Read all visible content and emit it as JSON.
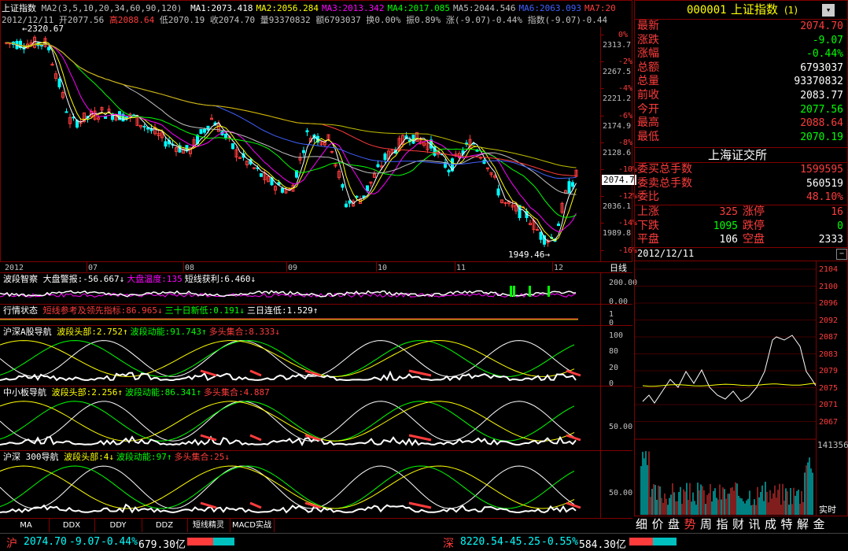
{
  "main_chart": {
    "title": "上证指数",
    "ma_label": "MA2(3,5,10,20,34,60,90,120)",
    "mas": [
      {
        "label": "MA1:2073.418",
        "color": "#ffffff"
      },
      {
        "label": "MA2:2056.284",
        "color": "#ffff00"
      },
      {
        "label": "MA3:2013.342",
        "color": "#ff00ff"
      },
      {
        "label": "MA4:2017.085",
        "color": "#00ff00"
      },
      {
        "label": "MA5:2044.546",
        "color": "#c0c0c0"
      },
      {
        "label": "MA6:2063.093",
        "color": "#4060ff"
      },
      {
        "label": "MA7:20",
        "color": "#ff3c3c"
      }
    ],
    "ohlc": {
      "date": "2012/12/11",
      "open": "开2077.56",
      "high": "高2088.64",
      "low": "低2070.19",
      "close": "收2074.70",
      "volume": "量93370832",
      "amount": "额6793037",
      "turnover": "换0.00%",
      "amplitude": "振0.89%",
      "change": "涨(-9.07)-0.44%",
      "index_change": "指数(-9.07)-0.44"
    },
    "high_marker": "2320.67",
    "low_marker": "1949.46",
    "current_tag": "2074.7",
    "y_axis": [
      {
        "pct": "0%",
        "val": "2313.7"
      },
      {
        "pct": "-2%",
        "val": "2267.5"
      },
      {
        "pct": "-4%",
        "val": "2221.2"
      },
      {
        "pct": "-6%",
        "val": "2174.9"
      },
      {
        "pct": "-8%",
        "val": "2128.6"
      },
      {
        "pct": "-10%",
        "val": "2082.3"
      },
      {
        "pct": "-12%",
        "val": "2036.1"
      },
      {
        "pct": "-14%",
        "val": "1989.8"
      },
      {
        "pct": "-16%",
        "val": ""
      }
    ],
    "x_axis": [
      "2012",
      "07",
      "08",
      "09",
      "10",
      "11",
      "12"
    ],
    "period_label": "日线"
  },
  "indicators": [
    {
      "name": "波段智察",
      "parts": [
        {
          "t": "大盘警报:-56.667↓",
          "c": "#ffffff"
        },
        {
          "t": "大盘温度:135",
          "c": "#ff00ff"
        },
        {
          "t": "短线获利:6.460↓",
          "c": "#ffffff"
        }
      ],
      "axis": [
        "200.00",
        "0.00"
      ]
    },
    {
      "name": "行情状态",
      "parts": [
        {
          "t": "短线参考及领先指标:86.965↓",
          "c": "#ff3c3c"
        },
        {
          "t": "三十日新低:0.191↓",
          "c": "#00ff00"
        },
        {
          "t": "三日连低:1.529↑",
          "c": "#ffffff"
        }
      ],
      "axis": [
        "1",
        "0"
      ]
    },
    {
      "name": "沪深A股导航",
      "parts": [
        {
          "t": "波段头部:2.752↑",
          "c": "#ffff00"
        },
        {
          "t": "波段动能:91.743↑",
          "c": "#00ff00"
        },
        {
          "t": "多头集合:8.333↓",
          "c": "#ff3c3c"
        }
      ],
      "axis": [
        "100",
        "80",
        "20",
        "0"
      ]
    },
    {
      "name": "中小板导航",
      "parts": [
        {
          "t": "波段头部:2.256↑",
          "c": "#ffff00"
        },
        {
          "t": "波段动能:86.341↑",
          "c": "#00ff00"
        },
        {
          "t": "多头集合:4.887",
          "c": "#ff3c3c"
        }
      ],
      "axis": [
        "50.00"
      ]
    },
    {
      "name": "沪深 300导航",
      "parts": [
        {
          "t": "波段头部:4↓",
          "c": "#ffff00"
        },
        {
          "t": "波段动能:97↑",
          "c": "#00ff00"
        },
        {
          "t": "多头集合:25↓",
          "c": "#ff3c3c"
        }
      ],
      "axis": [
        "50.00"
      ]
    }
  ],
  "bottom_tabs": [
    "MA",
    "DDX",
    "DDY",
    "DDZ",
    "短线精灵",
    "MACD实战"
  ],
  "quote_panel": {
    "code": "000001",
    "name": "上证指数",
    "suffix": "(1)",
    "rows": [
      {
        "label": "最新",
        "value": "2074.70",
        "color": "#ff3c3c"
      },
      {
        "label": "涨跌",
        "value": "-9.07",
        "color": "#00ff00"
      },
      {
        "label": "涨幅",
        "value": "-0.44%",
        "color": "#00ff00"
      },
      {
        "label": "总额",
        "value": "6793037",
        "color": "#ffffff"
      },
      {
        "label": "总量",
        "value": "93370832",
        "color": "#ffffff"
      },
      {
        "label": "前收",
        "value": "2083.77",
        "color": "#ffffff"
      },
      {
        "label": "今开",
        "value": "2077.56",
        "color": "#00ff00"
      },
      {
        "label": "最高",
        "value": "2088.64",
        "color": "#ff3c3c"
      },
      {
        "label": "最低",
        "value": "2070.19",
        "color": "#00ff00"
      }
    ],
    "exchange": "上海证交所",
    "ex_rows": [
      {
        "label": "委买总手数",
        "value": "1599595",
        "color": "#ff3c3c"
      },
      {
        "label": "委卖总手数",
        "value": "560519",
        "color": "#ffffff"
      },
      {
        "label": "委比",
        "value": "48.10%",
        "color": "#ff3c3c"
      }
    ],
    "breadth": [
      {
        "l1": "上涨",
        "v1": "325",
        "c1": "#ff3c3c",
        "l2": "涨停",
        "v2": "16",
        "c2": "#ff3c3c"
      },
      {
        "l1": "下跌",
        "v1": "1095",
        "c1": "#00ff00",
        "l2": "跌停",
        "v2": "0",
        "c2": "#00ff00"
      },
      {
        "l1": "平盘",
        "v1": "106",
        "c1": "#ffffff",
        "l2": "空盘",
        "v2": "2333",
        "c2": "#ffffff"
      }
    ]
  },
  "intraday": {
    "date": "2012/12/11",
    "y_axis": [
      "2104",
      "2100",
      "2096",
      "2092",
      "2087",
      "2083",
      "2079",
      "2075",
      "2071",
      "2067"
    ],
    "vol_max": "141356",
    "realtime": "实时"
  },
  "right_tabs": [
    "细",
    "价",
    "盘",
    "势",
    "周",
    "指",
    "财",
    "讯",
    "成",
    "特",
    "解",
    "金"
  ],
  "status_bar": {
    "sh_label": "沪",
    "sh_price": "2074.70",
    "sh_chg": "-9.07",
    "sh_pct": "-0.44%",
    "sh_amt": "679.30亿",
    "sz_label": "深",
    "sz_price": "8220.54",
    "sz_chg": "-45.25",
    "sz_pct": "-0.55%",
    "sz_amt": "584.30亿"
  }
}
